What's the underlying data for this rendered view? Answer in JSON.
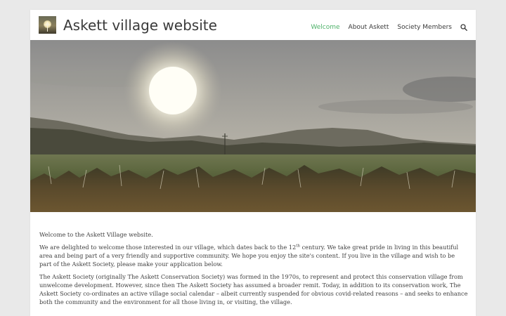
{
  "site": {
    "title": "Askett village website"
  },
  "nav": {
    "items": [
      {
        "label": "Welcome",
        "active": true
      },
      {
        "label": "About Askett",
        "active": false
      },
      {
        "label": "Society Members",
        "active": false
      }
    ],
    "search_icon": "search-icon"
  },
  "colors": {
    "accent": "#4fb26a",
    "text": "#3a3a3a",
    "background": "#e9e9e9"
  },
  "content": {
    "intro": "Welcome to the Askett Village website.",
    "p2_before": "We are delighted to welcome those interested in our village, which dates back to the 12",
    "p2_sup": "th",
    "p2_after": " century. We take great pride in living in this beautiful area and being part of a very friendly and supportive community. We hope you enjoy the site's content. If you live in the village and wish to be part of the Askett Society, please make your application below.",
    "p3": "The Askett Society (originally The Askett Conservation Society) was formed in the 1970s, to represent and protect this conservation village from unwelcome development. However, since then The Askett Society has assumed a broader remit. Today, in addition to its conservation work, The Askett Society co-ordinates an active village social calendar – albeit currently suspended for obvious covid-related reasons – and seeks to enhance both the community and the environment for all those living in, or visiting, the village."
  }
}
